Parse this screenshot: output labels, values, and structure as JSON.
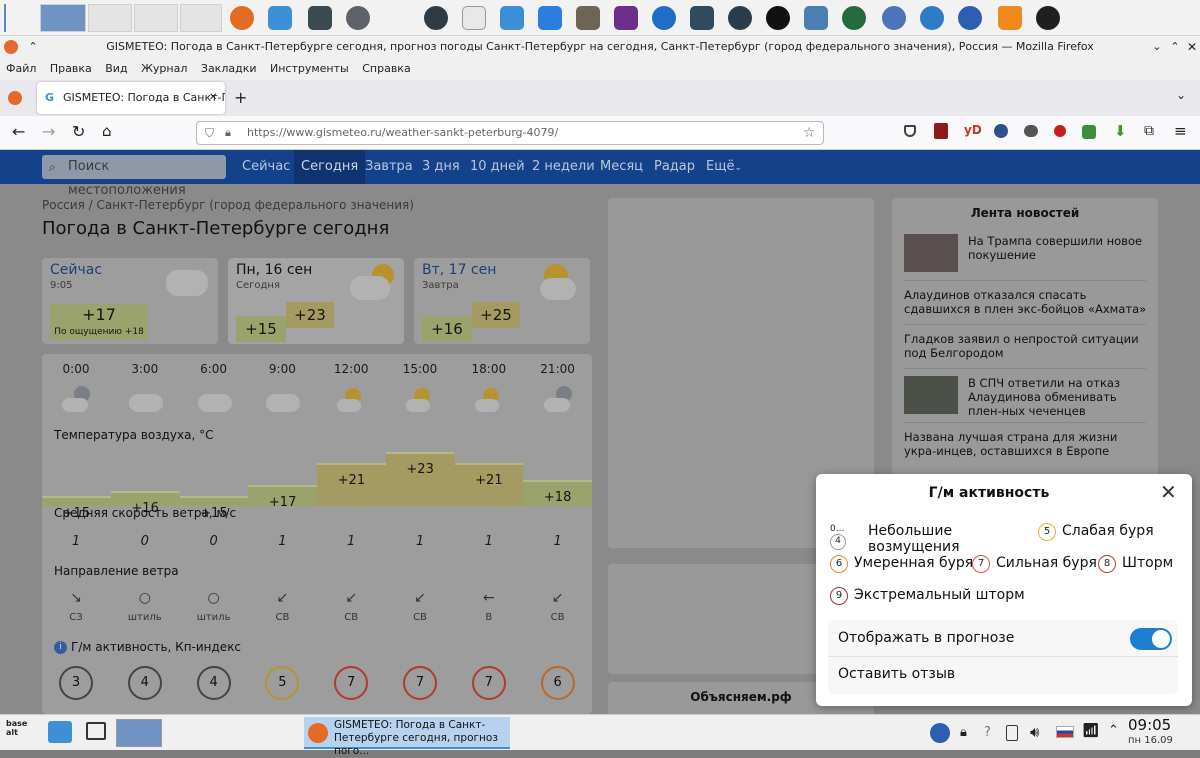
{
  "window": {
    "title": "GISMETEO: Погода в Санкт-Петербурге сегодня, прогноз погоды Санкт-Петербург на сегодня, Санкт-Петербург (город федерального значения), Россия — Mozilla Firefox"
  },
  "menu": [
    "Файл",
    "Правка",
    "Вид",
    "Журнал",
    "Закладки",
    "Инструменты",
    "Справка"
  ],
  "tab": {
    "label": "GISMETEO: Погода в Санкт-Петер",
    "icon": "G"
  },
  "url": "https://www.gismeteo.ru/weather-sankt-peterburg-4079/",
  "site": {
    "search_placeholder": "Поиск местоположения",
    "nav": [
      "Сейчас",
      "Сегодня",
      "Завтра",
      "3 дня",
      "10 дней",
      "2 недели",
      "Месяц",
      "Радар",
      "Ещё"
    ],
    "breadcrumb": "Россия / Санкт-Петербург (город федерального значения)",
    "title": "Погода в Санкт-Петербурге сегодня"
  },
  "now": {
    "label": "Сейчас",
    "time": "9:05",
    "temp": "+17",
    "feels": "По ощущению +18"
  },
  "today": {
    "label": "Пн, 16 сен",
    "sub": "Сегодня",
    "min": "+15",
    "max": "+23"
  },
  "tomorrow": {
    "label": "Вт, 17 сен",
    "sub": "Завтра",
    "min": "+16",
    "max": "+25"
  },
  "hourly": {
    "hours": [
      "0:00",
      "3:00",
      "6:00",
      "9:00",
      "12:00",
      "15:00",
      "18:00",
      "21:00"
    ],
    "icons": [
      "moon-cloud-icon",
      "cloud-icon",
      "cloud-icon",
      "cloud-icon",
      "sun-cloud-icon",
      "sun-cloud-icon",
      "sun-cloud-icon",
      "moon-cloud-icon"
    ],
    "temp_label": "Температура воздуха, °C",
    "temps": [
      "+15",
      "+16",
      "+15",
      "+17",
      "+21",
      "+23",
      "+21",
      "+18"
    ],
    "temp_levels": [
      15,
      16,
      15,
      17,
      21,
      23,
      21,
      18
    ],
    "wind_label": "Средняя скорость ветра, м/с",
    "wind": [
      "1",
      "0",
      "0",
      "1",
      "1",
      "1",
      "1",
      "1"
    ],
    "dir_label": "Направление ветра",
    "dir_arrows": [
      "↘",
      "○",
      "○",
      "↙",
      "↙",
      "↙",
      "←",
      "↙"
    ],
    "dirs": [
      "СЗ",
      "штиль",
      "штиль",
      "СВ",
      "СВ",
      "СВ",
      "В",
      "СВ"
    ],
    "kp_label": "Г/м активность, Кп-индекс",
    "kp": [
      "3",
      "4",
      "4",
      "5",
      "7",
      "7",
      "7",
      "6"
    ]
  },
  "news": {
    "title": "Лента новостей",
    "items": [
      "На Трампа совершили новое покушение",
      "Алаудинов отказался спасать сдавшихся в плен экс-бойцов «Ахмата»",
      "Гладков заявил о непростой ситуации под Белгородом",
      "В СПЧ ответили на отказ Алаудинова обменивать плен-ных чеченцев",
      "Названа лучшая страна для жизни укра-инцев, оставшихся в Европе"
    ]
  },
  "explain": "Объясняем.рф",
  "popup": {
    "title": "Г/м активность",
    "levels": [
      {
        "num": "0...4",
        "label": "Небольшие возмущения"
      },
      {
        "num": "5",
        "label": "Слабая буря"
      },
      {
        "num": "6",
        "label": "Умеренная буря"
      },
      {
        "num": "7",
        "label": "Сильная буря"
      },
      {
        "num": "8",
        "label": "Шторм"
      },
      {
        "num": "9",
        "label": "Экстремальный шторм"
      }
    ],
    "toggle_label": "Отображать в прогнозе",
    "toggle_on": true,
    "feedback": "Оставить отзыв"
  },
  "taskbar": {
    "task_label": "GISMETEO: Погода в Санкт-Петербурге сегодня, прогноз пого...",
    "clock_time": "09:05",
    "clock_date": "пн 16.09",
    "start_label": "base alt"
  }
}
